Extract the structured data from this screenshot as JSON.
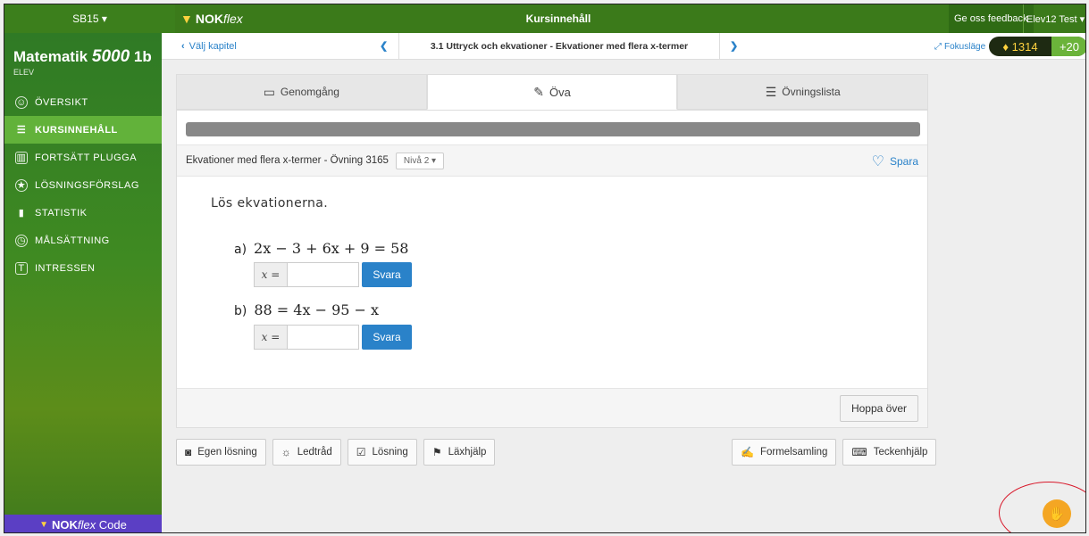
{
  "topbar": {
    "class_selector": "SB15 ▾",
    "brand_main": "NOK",
    "brand_italic": "flex",
    "title": "Kursinnehåll",
    "feedback": "Ge oss feedback",
    "user": "Elev12 Test ▾"
  },
  "sidebar": {
    "app_title": "Matematik",
    "app_title_number": "5000",
    "app_title_suffix": "1b",
    "role": "ELEV",
    "items": [
      {
        "label": "ÖVERSIKT",
        "icon": "overview-icon"
      },
      {
        "label": "KURSINNEHÅLL",
        "icon": "list-icon",
        "active": true
      },
      {
        "label": "FORTSÄTT PLUGGA",
        "icon": "book-icon"
      },
      {
        "label": "LÖSNINGSFÖRSLAG",
        "icon": "star-circle-icon"
      },
      {
        "label": "STATISTIK",
        "icon": "chart-icon"
      },
      {
        "label": "MÅLSÄTTNING",
        "icon": "clock-icon"
      },
      {
        "label": "INTRESSEN",
        "icon": "shirt-icon"
      }
    ],
    "code_brand": "NOK",
    "code_brand_italic": "flex",
    "code_suffix": "Code"
  },
  "subheader": {
    "back": "Välj kapitel",
    "chapter": "3.1 Uttryck och ekvationer - Ekvationer med flera x-termer",
    "focus": "Fokusläge",
    "points": "1314",
    "bonus": "+20"
  },
  "tabs": [
    {
      "label": "Genomgång",
      "icon": "book-open-icon"
    },
    {
      "label": "Öva",
      "icon": "pencil-icon",
      "active": true
    },
    {
      "label": "Övningslista",
      "icon": "checklist-icon"
    }
  ],
  "exercise": {
    "title": "Ekvationer med flera x-termer  -  Övning 3165",
    "level": "Nivå 2 ▾",
    "save": "Spara",
    "prompt": "Lös ekvationerna.",
    "questions": [
      {
        "label": "a)",
        "equation": "2x − 3 + 6x + 9 = 58",
        "prefix": "x =",
        "button": "Svara"
      },
      {
        "label": "b)",
        "equation": "88 = 4x − 95 − x",
        "prefix": "x =",
        "button": "Svara"
      }
    ],
    "skip": "Hoppa över"
  },
  "tools_left": [
    {
      "label": "Egen lösning",
      "icon": "camera-icon"
    },
    {
      "label": "Ledtråd",
      "icon": "lightbulb-icon"
    },
    {
      "label": "Lösning",
      "icon": "solution-icon"
    },
    {
      "label": "Läxhjälp",
      "icon": "flag-icon"
    }
  ],
  "tools_right": [
    {
      "label": "Formelsamling",
      "icon": "formula-icon"
    },
    {
      "label": "Teckenhjälp",
      "icon": "keyboard-icon"
    }
  ],
  "colors": {
    "brand_green": "#3b7a1a",
    "active_green": "#62b23a",
    "link_blue": "#2a82c9",
    "code_purple": "#5b3fc4",
    "help_orange": "#f4a623",
    "annotation_red": "#d8182a"
  }
}
